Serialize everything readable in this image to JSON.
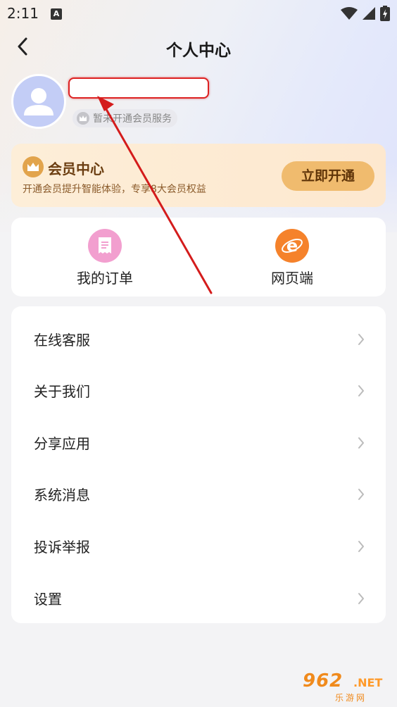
{
  "status_bar": {
    "time": "2:11",
    "notification_glyph": "A",
    "icons": [
      "wifi-icon",
      "signal-icon",
      "battery-icon"
    ]
  },
  "header": {
    "title": "个人中心",
    "back_icon": "chevron-left-icon"
  },
  "profile": {
    "avatar_icon": "user-avatar-icon",
    "username": "",
    "vip_status": "暂未开通会员服务"
  },
  "vip_card": {
    "title": "会员中心",
    "description": "开通会员提升智能体验，专享8大会员权益",
    "button_label": "立即开通",
    "accent_color": "#e2a44c"
  },
  "shortcuts": [
    {
      "label": "我的订单",
      "icon": "receipt-icon",
      "color": "#f29fcf"
    },
    {
      "label": "网页端",
      "icon": "browser-e-icon",
      "color": "#f5822b"
    }
  ],
  "menu": [
    {
      "label": "在线客服"
    },
    {
      "label": "关于我们"
    },
    {
      "label": "分享应用"
    },
    {
      "label": "系统消息"
    },
    {
      "label": "投诉举报"
    },
    {
      "label": "设置"
    }
  ],
  "watermark": {
    "main": "962",
    "suffix": ".NET",
    "sub": "乐游网"
  }
}
